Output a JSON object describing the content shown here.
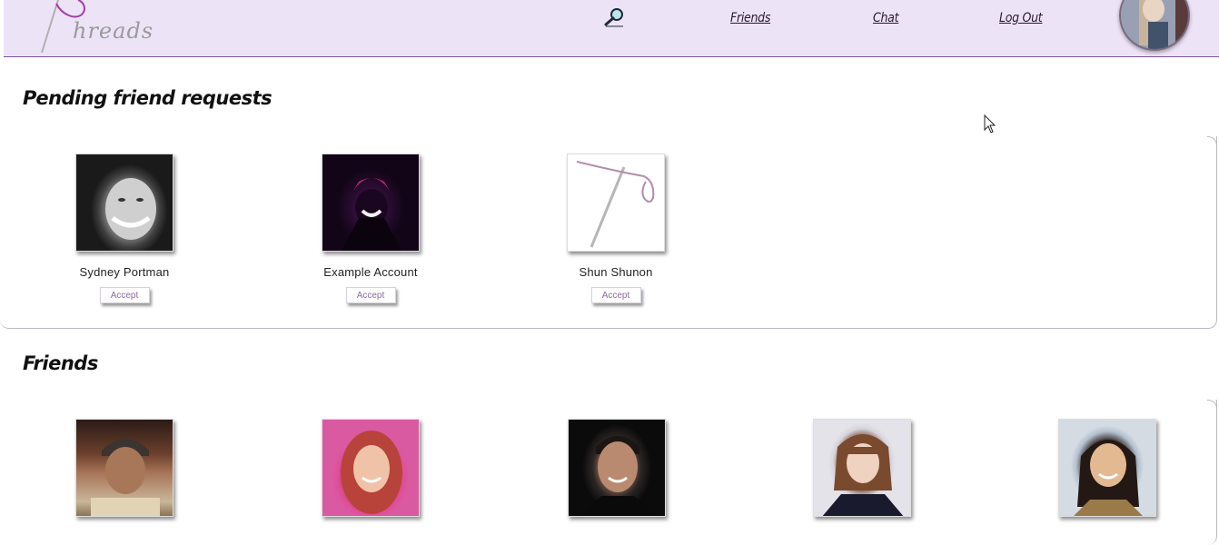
{
  "header": {
    "logo_text": "hreads",
    "nav": {
      "friends": "Friends",
      "chat": "Chat",
      "logout": "Log Out"
    },
    "accent_color": "#7d4f8e",
    "background_color": "#ede3f7"
  },
  "pending": {
    "title": "Pending friend requests",
    "requests": [
      {
        "name": "Sydney Portman",
        "button": "Accept"
      },
      {
        "name": "Example Account",
        "button": "Accept"
      },
      {
        "name": "Shun Shunon",
        "button": "Accept"
      }
    ]
  },
  "friends": {
    "title": "Friends",
    "count_visible": 5
  },
  "icons": {
    "search": "magnifier-icon",
    "logo": "needle-thread-icon"
  }
}
